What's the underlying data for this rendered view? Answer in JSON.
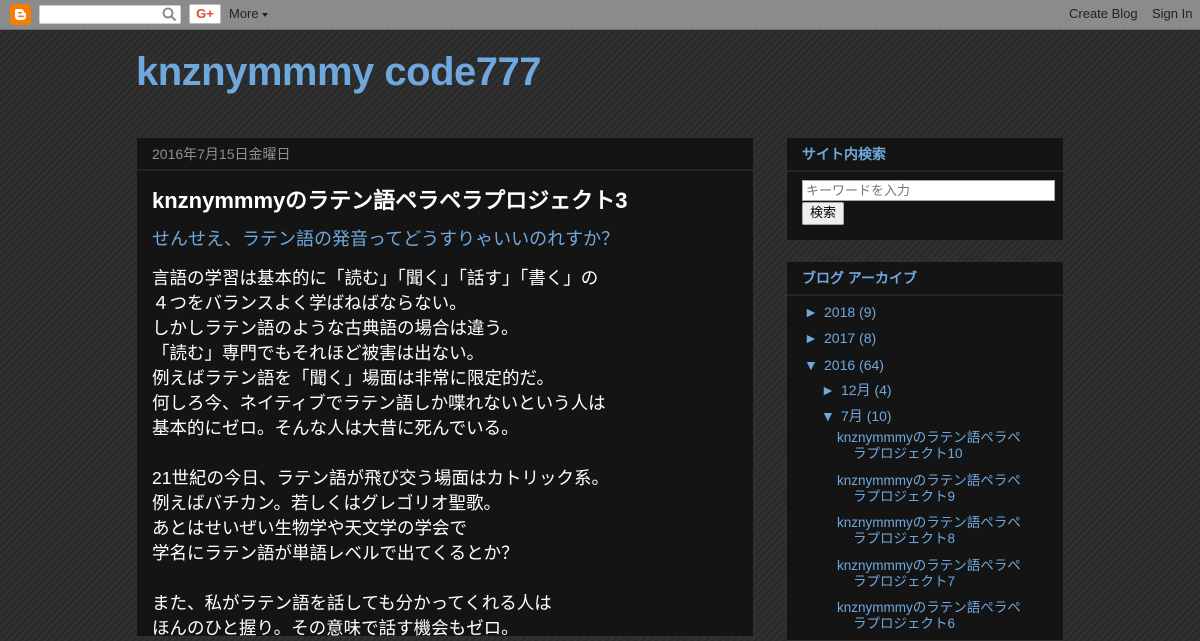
{
  "navbar": {
    "more_label": "More",
    "create_blog_label": "Create Blog",
    "sign_in_label": "Sign In",
    "gplus_label": "G+"
  },
  "blog": {
    "title": "knznymmmy code777"
  },
  "post": {
    "date": "2016年7月15日金曜日",
    "title": "knznymmmyのラテン語ペラペラプロジェクト3",
    "subtitle": "せんせえ、ラテン語の発音ってどうすりゃいいのれすか？",
    "body_lines": [
      "言語の学習は基本的に「読む」「聞く」「話す」「書く」の",
      "４つをバランスよく学ばねばならない。",
      "しかしラテン語のような古典語の場合は違う。",
      "「読む」専門でもそれほど被害は出ない。",
      "例えばラテン語を「聞く」場面は非常に限定的だ。",
      "何しろ今、ネイティブでラテン語しか喋れないという人は",
      "基本的にゼロ。そんな人は大昔に死んでいる。",
      "",
      "21世紀の今日、ラテン語が飛び交う場面はカトリック系。",
      "例えばバチカン。若しくはグレゴリオ聖歌。",
      "あとはせいぜい生物学や天文学の学会で",
      "学名にラテン語が単語レベルで出てくるとか？",
      "",
      "また、私がラテン語を話しても分かってくれる人は",
      "ほんのひと握り。その意味で話す機会もゼロ。"
    ]
  },
  "sidebar": {
    "search": {
      "title": "サイト内検索",
      "placeholder": "キーワードを入力",
      "button_label": "検索"
    },
    "archive": {
      "title": "ブログ アーカイブ",
      "years": [
        {
          "toggle": "►",
          "label": "2018",
          "count": "(9)"
        },
        {
          "toggle": "►",
          "label": "2017",
          "count": "(8)"
        },
        {
          "toggle": "▼",
          "label": "2016",
          "count": "(64)"
        }
      ],
      "months": [
        {
          "toggle": "►",
          "label": "12月",
          "count": "(4)"
        },
        {
          "toggle": "▼",
          "label": "7月",
          "count": "(10)"
        }
      ],
      "posts": [
        "knznymmmyのラテン語ペラペラプロジェクト10",
        "knznymmmyのラテン語ペラペラプロジェクト9",
        "knznymmmyのラテン語ペラペラプロジェクト8",
        "knznymmmyのラテン語ペラペラプロジェクト7",
        "knznymmmyのラテン語ペラペラプロジェクト6"
      ]
    }
  },
  "colors": {
    "link": "#6fa8dc",
    "blogger_orange": "#f57d00"
  }
}
